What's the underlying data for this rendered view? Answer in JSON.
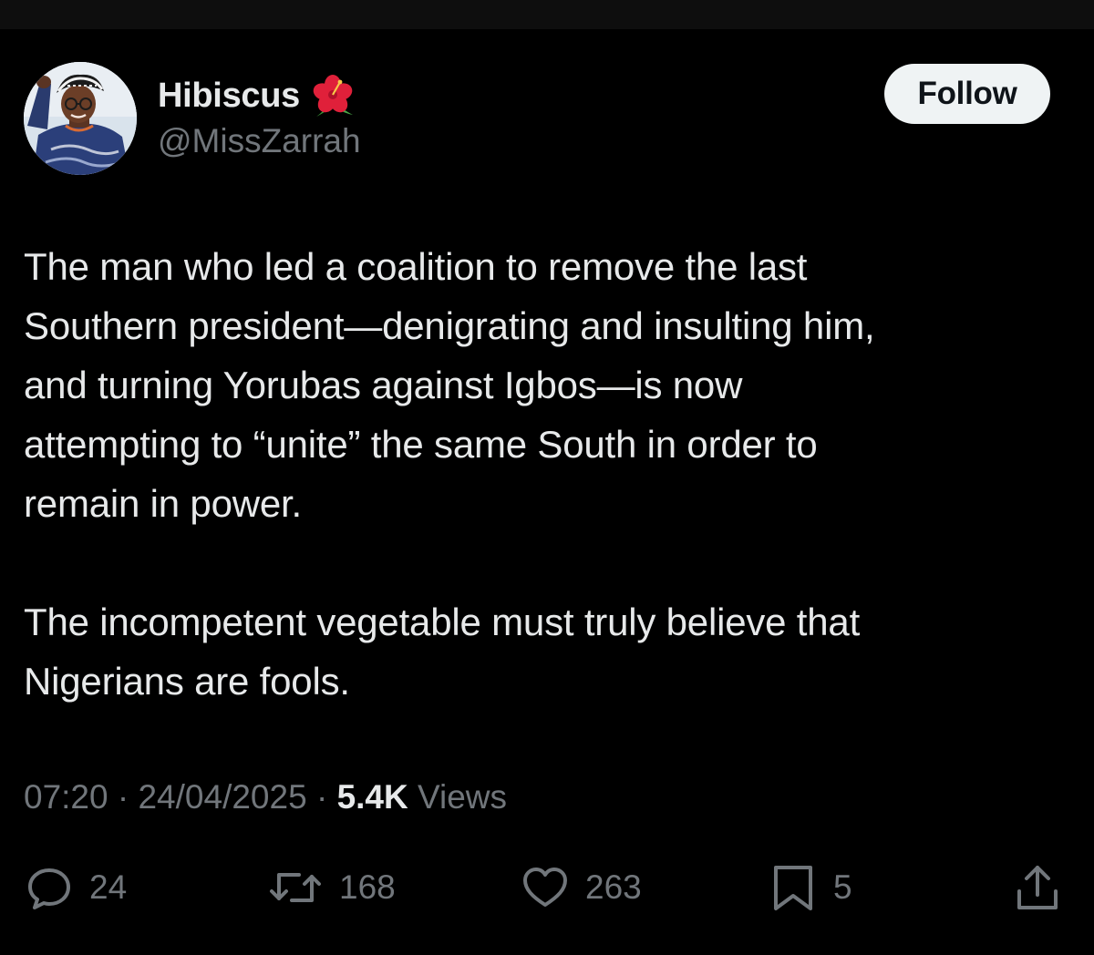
{
  "author": {
    "display_name": "Hibiscus",
    "handle": "@MissZarrah",
    "emoji_icon": "hibiscus-emoji",
    "avatar_icon": "profile-photo"
  },
  "follow_button": {
    "label": "Follow"
  },
  "tweet": {
    "paragraphs": [
      "The man who led a coalition to remove the last\nSouthern president—denigrating and insulting him,\nand turning Yorubas against Igbos—is now\nattempting to “unite” the same South in order to\nremain in power.",
      "The incompetent vegetable must truly believe that\nNigerians are fools."
    ]
  },
  "meta": {
    "time": "07:20",
    "separator": "·",
    "date": "24/04/2025",
    "views_count": "5.4K",
    "views_label": "Views"
  },
  "actions": {
    "reply": {
      "icon": "reply-icon",
      "count": "24"
    },
    "repost": {
      "icon": "repost-icon",
      "count": "168"
    },
    "like": {
      "icon": "heart-icon",
      "count": "263"
    },
    "bookmark": {
      "icon": "bookmark-icon",
      "count": "5"
    },
    "share": {
      "icon": "share-icon"
    }
  },
  "colors": {
    "background": "#000000",
    "primary_text": "#e7e9ea",
    "secondary_text": "#71767b",
    "follow_button_bg": "#eff3f4",
    "follow_button_text": "#0f1419",
    "hibiscus_red": "#e0203a"
  }
}
